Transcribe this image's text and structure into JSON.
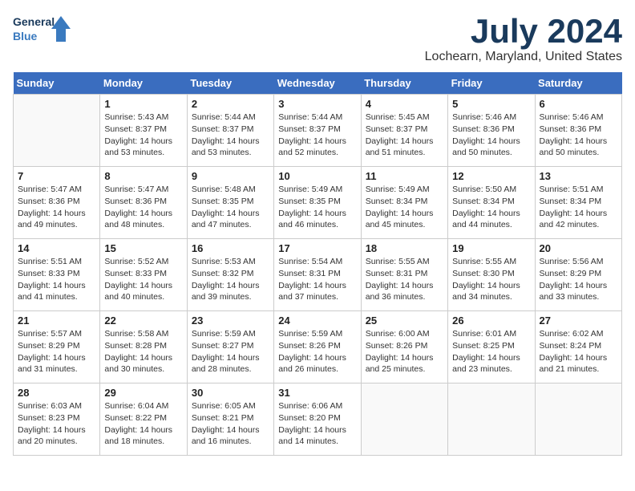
{
  "header": {
    "logo_line1": "General",
    "logo_line2": "Blue",
    "title": "July 2024",
    "subtitle": "Lochearn, Maryland, United States"
  },
  "columns": [
    "Sunday",
    "Monday",
    "Tuesday",
    "Wednesday",
    "Thursday",
    "Friday",
    "Saturday"
  ],
  "weeks": [
    [
      {
        "day": "",
        "info": ""
      },
      {
        "day": "1",
        "info": "Sunrise: 5:43 AM\nSunset: 8:37 PM\nDaylight: 14 hours\nand 53 minutes."
      },
      {
        "day": "2",
        "info": "Sunrise: 5:44 AM\nSunset: 8:37 PM\nDaylight: 14 hours\nand 53 minutes."
      },
      {
        "day": "3",
        "info": "Sunrise: 5:44 AM\nSunset: 8:37 PM\nDaylight: 14 hours\nand 52 minutes."
      },
      {
        "day": "4",
        "info": "Sunrise: 5:45 AM\nSunset: 8:37 PM\nDaylight: 14 hours\nand 51 minutes."
      },
      {
        "day": "5",
        "info": "Sunrise: 5:46 AM\nSunset: 8:36 PM\nDaylight: 14 hours\nand 50 minutes."
      },
      {
        "day": "6",
        "info": "Sunrise: 5:46 AM\nSunset: 8:36 PM\nDaylight: 14 hours\nand 50 minutes."
      }
    ],
    [
      {
        "day": "7",
        "info": "Sunrise: 5:47 AM\nSunset: 8:36 PM\nDaylight: 14 hours\nand 49 minutes."
      },
      {
        "day": "8",
        "info": "Sunrise: 5:47 AM\nSunset: 8:36 PM\nDaylight: 14 hours\nand 48 minutes."
      },
      {
        "day": "9",
        "info": "Sunrise: 5:48 AM\nSunset: 8:35 PM\nDaylight: 14 hours\nand 47 minutes."
      },
      {
        "day": "10",
        "info": "Sunrise: 5:49 AM\nSunset: 8:35 PM\nDaylight: 14 hours\nand 46 minutes."
      },
      {
        "day": "11",
        "info": "Sunrise: 5:49 AM\nSunset: 8:34 PM\nDaylight: 14 hours\nand 45 minutes."
      },
      {
        "day": "12",
        "info": "Sunrise: 5:50 AM\nSunset: 8:34 PM\nDaylight: 14 hours\nand 44 minutes."
      },
      {
        "day": "13",
        "info": "Sunrise: 5:51 AM\nSunset: 8:34 PM\nDaylight: 14 hours\nand 42 minutes."
      }
    ],
    [
      {
        "day": "14",
        "info": "Sunrise: 5:51 AM\nSunset: 8:33 PM\nDaylight: 14 hours\nand 41 minutes."
      },
      {
        "day": "15",
        "info": "Sunrise: 5:52 AM\nSunset: 8:33 PM\nDaylight: 14 hours\nand 40 minutes."
      },
      {
        "day": "16",
        "info": "Sunrise: 5:53 AM\nSunset: 8:32 PM\nDaylight: 14 hours\nand 39 minutes."
      },
      {
        "day": "17",
        "info": "Sunrise: 5:54 AM\nSunset: 8:31 PM\nDaylight: 14 hours\nand 37 minutes."
      },
      {
        "day": "18",
        "info": "Sunrise: 5:55 AM\nSunset: 8:31 PM\nDaylight: 14 hours\nand 36 minutes."
      },
      {
        "day": "19",
        "info": "Sunrise: 5:55 AM\nSunset: 8:30 PM\nDaylight: 14 hours\nand 34 minutes."
      },
      {
        "day": "20",
        "info": "Sunrise: 5:56 AM\nSunset: 8:29 PM\nDaylight: 14 hours\nand 33 minutes."
      }
    ],
    [
      {
        "day": "21",
        "info": "Sunrise: 5:57 AM\nSunset: 8:29 PM\nDaylight: 14 hours\nand 31 minutes."
      },
      {
        "day": "22",
        "info": "Sunrise: 5:58 AM\nSunset: 8:28 PM\nDaylight: 14 hours\nand 30 minutes."
      },
      {
        "day": "23",
        "info": "Sunrise: 5:59 AM\nSunset: 8:27 PM\nDaylight: 14 hours\nand 28 minutes."
      },
      {
        "day": "24",
        "info": "Sunrise: 5:59 AM\nSunset: 8:26 PM\nDaylight: 14 hours\nand 26 minutes."
      },
      {
        "day": "25",
        "info": "Sunrise: 6:00 AM\nSunset: 8:26 PM\nDaylight: 14 hours\nand 25 minutes."
      },
      {
        "day": "26",
        "info": "Sunrise: 6:01 AM\nSunset: 8:25 PM\nDaylight: 14 hours\nand 23 minutes."
      },
      {
        "day": "27",
        "info": "Sunrise: 6:02 AM\nSunset: 8:24 PM\nDaylight: 14 hours\nand 21 minutes."
      }
    ],
    [
      {
        "day": "28",
        "info": "Sunrise: 6:03 AM\nSunset: 8:23 PM\nDaylight: 14 hours\nand 20 minutes."
      },
      {
        "day": "29",
        "info": "Sunrise: 6:04 AM\nSunset: 8:22 PM\nDaylight: 14 hours\nand 18 minutes."
      },
      {
        "day": "30",
        "info": "Sunrise: 6:05 AM\nSunset: 8:21 PM\nDaylight: 14 hours\nand 16 minutes."
      },
      {
        "day": "31",
        "info": "Sunrise: 6:06 AM\nSunset: 8:20 PM\nDaylight: 14 hours\nand 14 minutes."
      },
      {
        "day": "",
        "info": ""
      },
      {
        "day": "",
        "info": ""
      },
      {
        "day": "",
        "info": ""
      }
    ]
  ]
}
